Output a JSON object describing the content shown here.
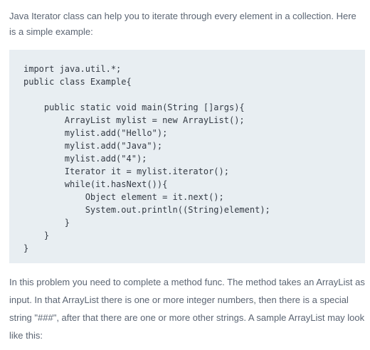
{
  "intro": "Java Iterator class can help you to iterate through every element in a collection. Here is a simple example:",
  "code_lines": [
    "import java.util.*;",
    "public class Example{",
    "",
    "    public static void main(String []args){",
    "        ArrayList mylist = new ArrayList();",
    "        mylist.add(\"Hello\");",
    "        mylist.add(\"Java\");",
    "        mylist.add(\"4\");",
    "        Iterator it = mylist.iterator();",
    "        while(it.hasNext()){",
    "            Object element = it.next();",
    "            System.out.println((String)element);",
    "        }",
    "    }",
    "}"
  ],
  "description": "In this problem you need to complete a method func. The method takes an ArrayList as input. In that ArrayList there is one or more integer numbers, then there is a special string \"###\", after that there are one or more other strings. A sample ArrayList may look like this:"
}
